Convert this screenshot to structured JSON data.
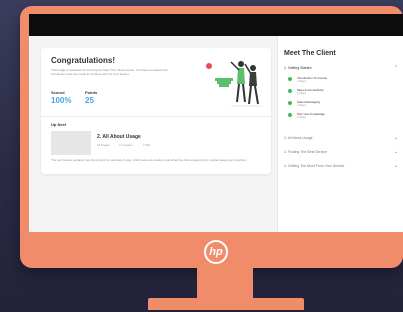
{
  "brand": {
    "logo_text": "hp"
  },
  "main": {
    "congrats_title": "Congratulations!",
    "congrats_text": "This badge is awarded for finishing the Meet The Client course. You have completed the introduction and are ready to continue with the next lesson.",
    "stats": [
      {
        "label": "Scored",
        "value": "100%"
      },
      {
        "label": "Points",
        "value": "25"
      }
    ],
    "up_next": {
      "label": "Up Next",
      "title": "2. All About Usage",
      "meta": [
        "18 Pages",
        "7 Lessons",
        "7 Min"
      ],
      "description": "The next lesson explains how the product is used day to day, which tools are needed, and what the client expects from regular usage and reporting."
    }
  },
  "sidebar": {
    "title": "Meet The Client",
    "sections": [
      {
        "label": "1. Getting Started",
        "lessons": [
          {
            "title": "Introduction To Course",
            "subtitle": "2 Pages"
          },
          {
            "title": "Meet & Connectivity",
            "subtitle": "2 Pages"
          },
          {
            "title": "Cleint Messaging",
            "subtitle": "2 Pages"
          },
          {
            "title": "Test Your Knowledge",
            "subtitle": "2 Pages"
          }
        ]
      },
      {
        "label": "2. All About Usage",
        "lessons": []
      },
      {
        "label": "3. Finding The Best Service",
        "lessons": []
      },
      {
        "label": "4. Getting The Most From Your Service",
        "lessons": []
      }
    ]
  },
  "colors": {
    "accent": "#4aa4e4",
    "complete": "#46b85d",
    "frame": "#f08c6a",
    "background": "#2b2a45"
  }
}
